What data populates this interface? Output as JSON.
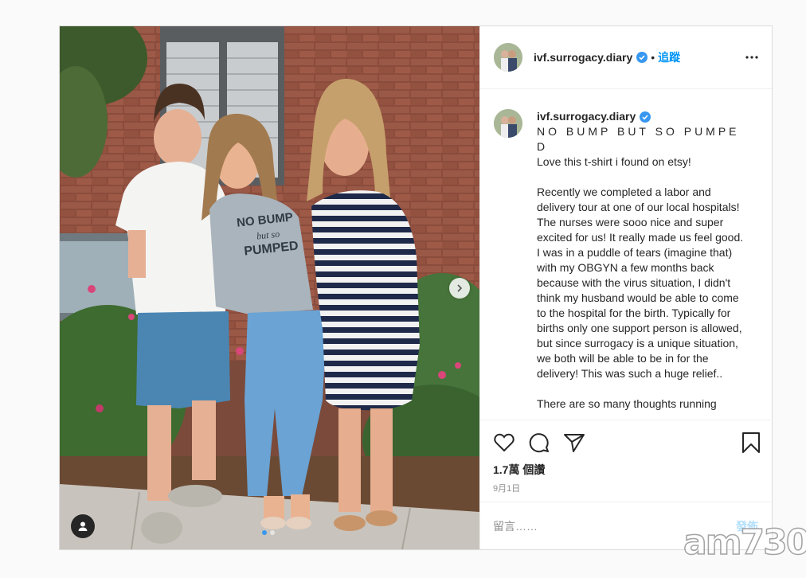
{
  "post": {
    "username": "ivf.surrogacy.diary",
    "separator": "•",
    "follow_label": "追蹤",
    "caption_line1": "NO BUMP BUT SO PUMPE D",
    "caption_text": "Love this t-shirt i found on etsy!\n\nRecently we completed a labor and delivery tour at one of our local hospitals! The nurses were sooo nice and super excited for us! It really made us feel good. I was in a puddle of tears (imagine that) with my OBGYN a few months back because with the virus situation, I didn't think my husband would be able to come to the hospital for the birth. Typically for births only one support person is allowed, but since surrogacy is a unique situation, we both will be able to be in for the delivery! This was such a huge relief..\n\nThere are so many thoughts running",
    "likes": "1.7萬 個讚",
    "date": "9月1日",
    "comment_placeholder": "留言……",
    "post_label": "發佈"
  },
  "photo": {
    "shirt_lines": [
      "NO BUMP",
      "but so",
      "PUMPED"
    ]
  },
  "watermark": "am730",
  "colors": {
    "link": "#0095f6",
    "verified": "#3897f0",
    "post_disabled": "#b2dffc",
    "muted": "#8e8e8e"
  },
  "icons": [
    "chevron-right-icon",
    "user-tag-icon",
    "verified-badge-icon",
    "more-icon",
    "heart-icon",
    "comment-icon",
    "share-icon",
    "bookmark-icon"
  ]
}
